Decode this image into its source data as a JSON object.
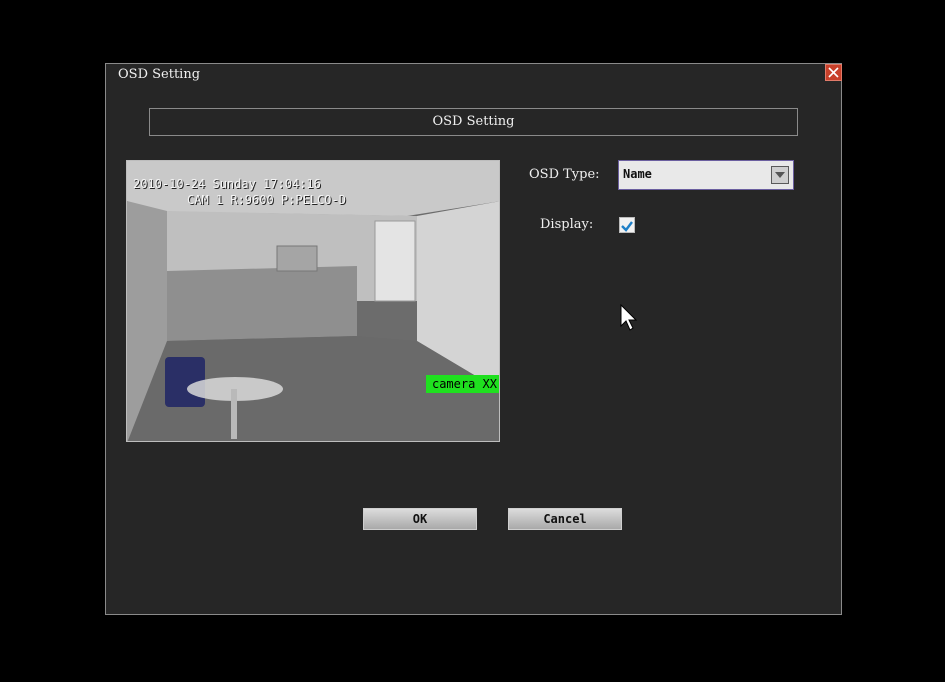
{
  "window": {
    "title": "OSD Setting"
  },
  "section": {
    "header": "OSD Setting"
  },
  "preview": {
    "osd_datetime": "2010-10-24 Sunday 17:04:16",
    "osd_camera_info": "CAM 1   R:9600 P:PELCO-D",
    "osd_name": "camera  XX"
  },
  "form": {
    "osd_type_label": "OSD Type:",
    "osd_type_value": "Name",
    "display_label": "Display:",
    "display_checked": true
  },
  "buttons": {
    "ok": "OK",
    "cancel": "Cancel"
  },
  "colors": {
    "osd_name_bg": "#1fe01f",
    "window_bg": "#262626",
    "close": "#c8402a"
  }
}
